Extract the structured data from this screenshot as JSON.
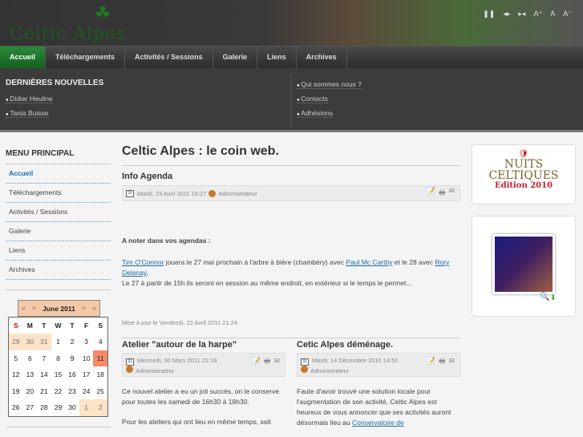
{
  "header": {
    "logo": "Celtic Alpes",
    "tools": [
      "❚❚",
      "◂▸",
      "▸◂",
      "A⁺",
      "A",
      "A⁻"
    ]
  },
  "nav": [
    "Accueil",
    "Téléchargements",
    "Activités / Sessions",
    "Galerie",
    "Liens",
    "Archives"
  ],
  "dropdown": {
    "title": "DERNIÈRES NOUVELLES",
    "news": [
      "Didier Heuline",
      "Tania Buisse"
    ],
    "links": [
      "Qui sommes nous ?",
      "Contacts",
      "Adhésions"
    ]
  },
  "menu": {
    "title": "MENU PRINCIPAL",
    "items": [
      "Accueil",
      "Téléchargements",
      "Activités / Sessions",
      "Galerie",
      "Liens",
      "Archives"
    ]
  },
  "calendar": {
    "prev_year": "«",
    "prev": "<",
    "month": "June 2011",
    "next": ">",
    "next_year": "»",
    "days": [
      "S",
      "M",
      "T",
      "W",
      "T",
      "F",
      "S"
    ],
    "weeks": [
      [
        "29",
        "30",
        "31",
        "1",
        "2",
        "3",
        "4"
      ],
      [
        "5",
        "6",
        "7",
        "8",
        "9",
        "10",
        "11"
      ],
      [
        "12",
        "13",
        "14",
        "15",
        "16",
        "17",
        "18"
      ],
      [
        "19",
        "20",
        "21",
        "22",
        "23",
        "24",
        "25"
      ],
      [
        "26",
        "27",
        "28",
        "29",
        "30",
        "1",
        "2"
      ]
    ]
  },
  "main": {
    "title": "Celtic Alpes : le coin web.",
    "article": {
      "title": "Info Agenda",
      "date": "Mardi, 19 Avril 2011 16:27",
      "author": "Administrateur",
      "subtitle": "A noter dans vos agendas :",
      "link1": "Tim O'Connor",
      "text1": " jouera le 27 mai prochain à l'arbre à bière (chambéry) avec ",
      "link2": "Paul Mc Carthy",
      "text2": " et le 28 avec ",
      "link3": "Rory Delanay",
      "text3": ",",
      "text4": "Le 27 à partir de 15h ils seront en session au même endroit, en extérieur si le temps le permet...",
      "updated": "Mise à jour le Vendredi, 22 Avril 2011 21:24"
    },
    "col1": {
      "title": "Atelier \"autour de la harpe\"",
      "date": "Mercredi, 30 Mars 2011 21:19",
      "author": "Administrateur",
      "p1": "Ce nouvel atelier a eu un joli succès, on le conserve pour toutes les samedi de 16h30 à 18h30.",
      "p2": "Pour les ateliers qui ont lieu en même temps, soit"
    },
    "col2": {
      "title": "Cetic Alpes déménage.",
      "date": "Mardi, 14 Décembre 2010 14:51",
      "author": "Administrateur",
      "p1": "Faute d'avoir trouvé une solution locale pour l'augmentation de son activité, Celtic Alpes est heureux de vous annoncer que ses activités auront désormais lieu au ",
      "link": "Conservatoire de"
    }
  },
  "right": {
    "banner_line1": "NUITS",
    "banner_line2": "CELTIQUES",
    "banner_edition": "Edition 2010"
  }
}
